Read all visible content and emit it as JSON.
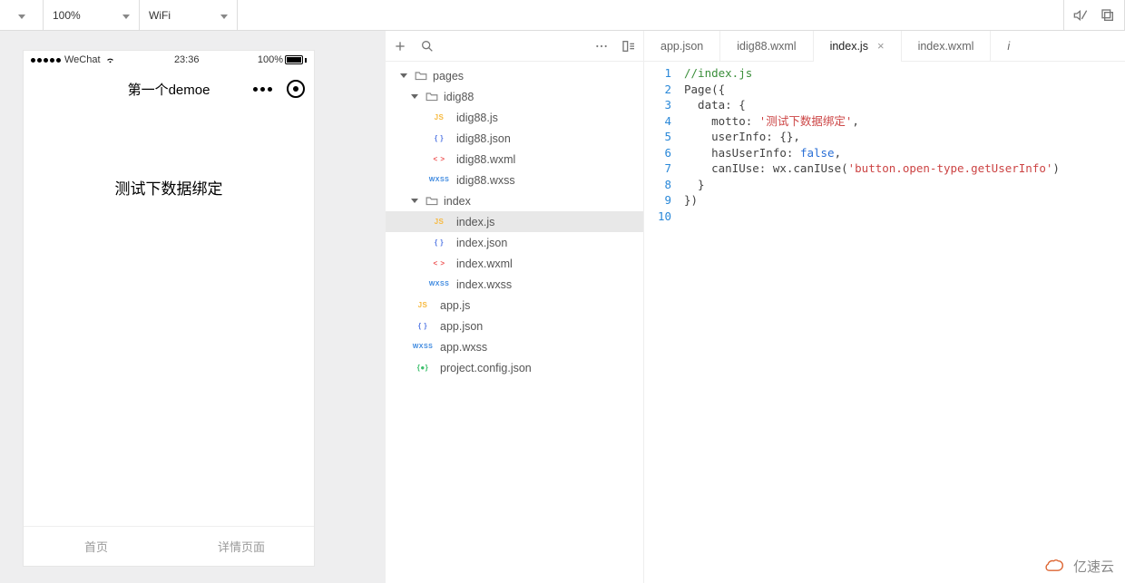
{
  "toolbar": {
    "zoom": "100%",
    "network": "WiFi"
  },
  "simulator": {
    "status": {
      "carrier": "WeChat",
      "time": "23:36",
      "batteryPct": "100%"
    },
    "nav": {
      "title": "第一个demoe"
    },
    "body_text": "测试下数据绑定",
    "tabs": [
      "首页",
      "详情页面"
    ]
  },
  "file_tree": {
    "root": "pages",
    "folders": [
      {
        "name": "idig88",
        "files": [
          {
            "name": "idig88.js",
            "type": "js"
          },
          {
            "name": "idig88.json",
            "type": "json"
          },
          {
            "name": "idig88.wxml",
            "type": "wxml"
          },
          {
            "name": "idig88.wxss",
            "type": "wxss"
          }
        ]
      },
      {
        "name": "index",
        "files": [
          {
            "name": "index.js",
            "type": "js",
            "selected": true
          },
          {
            "name": "index.json",
            "type": "json"
          },
          {
            "name": "index.wxml",
            "type": "wxml"
          },
          {
            "name": "index.wxss",
            "type": "wxss"
          }
        ]
      }
    ],
    "root_files": [
      {
        "name": "app.js",
        "type": "js"
      },
      {
        "name": "app.json",
        "type": "json"
      },
      {
        "name": "app.wxss",
        "type": "wxss"
      },
      {
        "name": "project.config.json",
        "type": "cfg"
      }
    ]
  },
  "editor_tabs": [
    {
      "label": "app.json",
      "active": false
    },
    {
      "label": "idig88.wxml",
      "active": false
    },
    {
      "label": "index.js",
      "active": true
    },
    {
      "label": "index.wxml",
      "active": false
    },
    {
      "label": "i",
      "active": false,
      "overflow": true
    }
  ],
  "editor": {
    "line_numbers": [
      "1",
      "2",
      "3",
      "4",
      "5",
      "6",
      "7",
      "8",
      "9",
      "10"
    ],
    "code": {
      "l1": "//index.js",
      "l2": "Page({",
      "l3": "  data: {",
      "l4_pre": "    motto: ",
      "l4_str": "'测试下数据绑定'",
      "l4_post": ",",
      "l5": "    userInfo: {},",
      "l6_pre": "    hasUserInfo: ",
      "l6_kw": "false",
      "l6_post": ",",
      "l7_pre": "    canIUse: wx.canIUse(",
      "l7_str": "'button.open-type.getUserInfo'",
      "l7_post": ")",
      "l8": "  }",
      "l9": "})"
    }
  },
  "icon_badges": {
    "js": "JS",
    "json": "{ }",
    "wxml": "< >",
    "wxss": "WXSS",
    "cfg": "{●}"
  },
  "watermark": "亿速云"
}
